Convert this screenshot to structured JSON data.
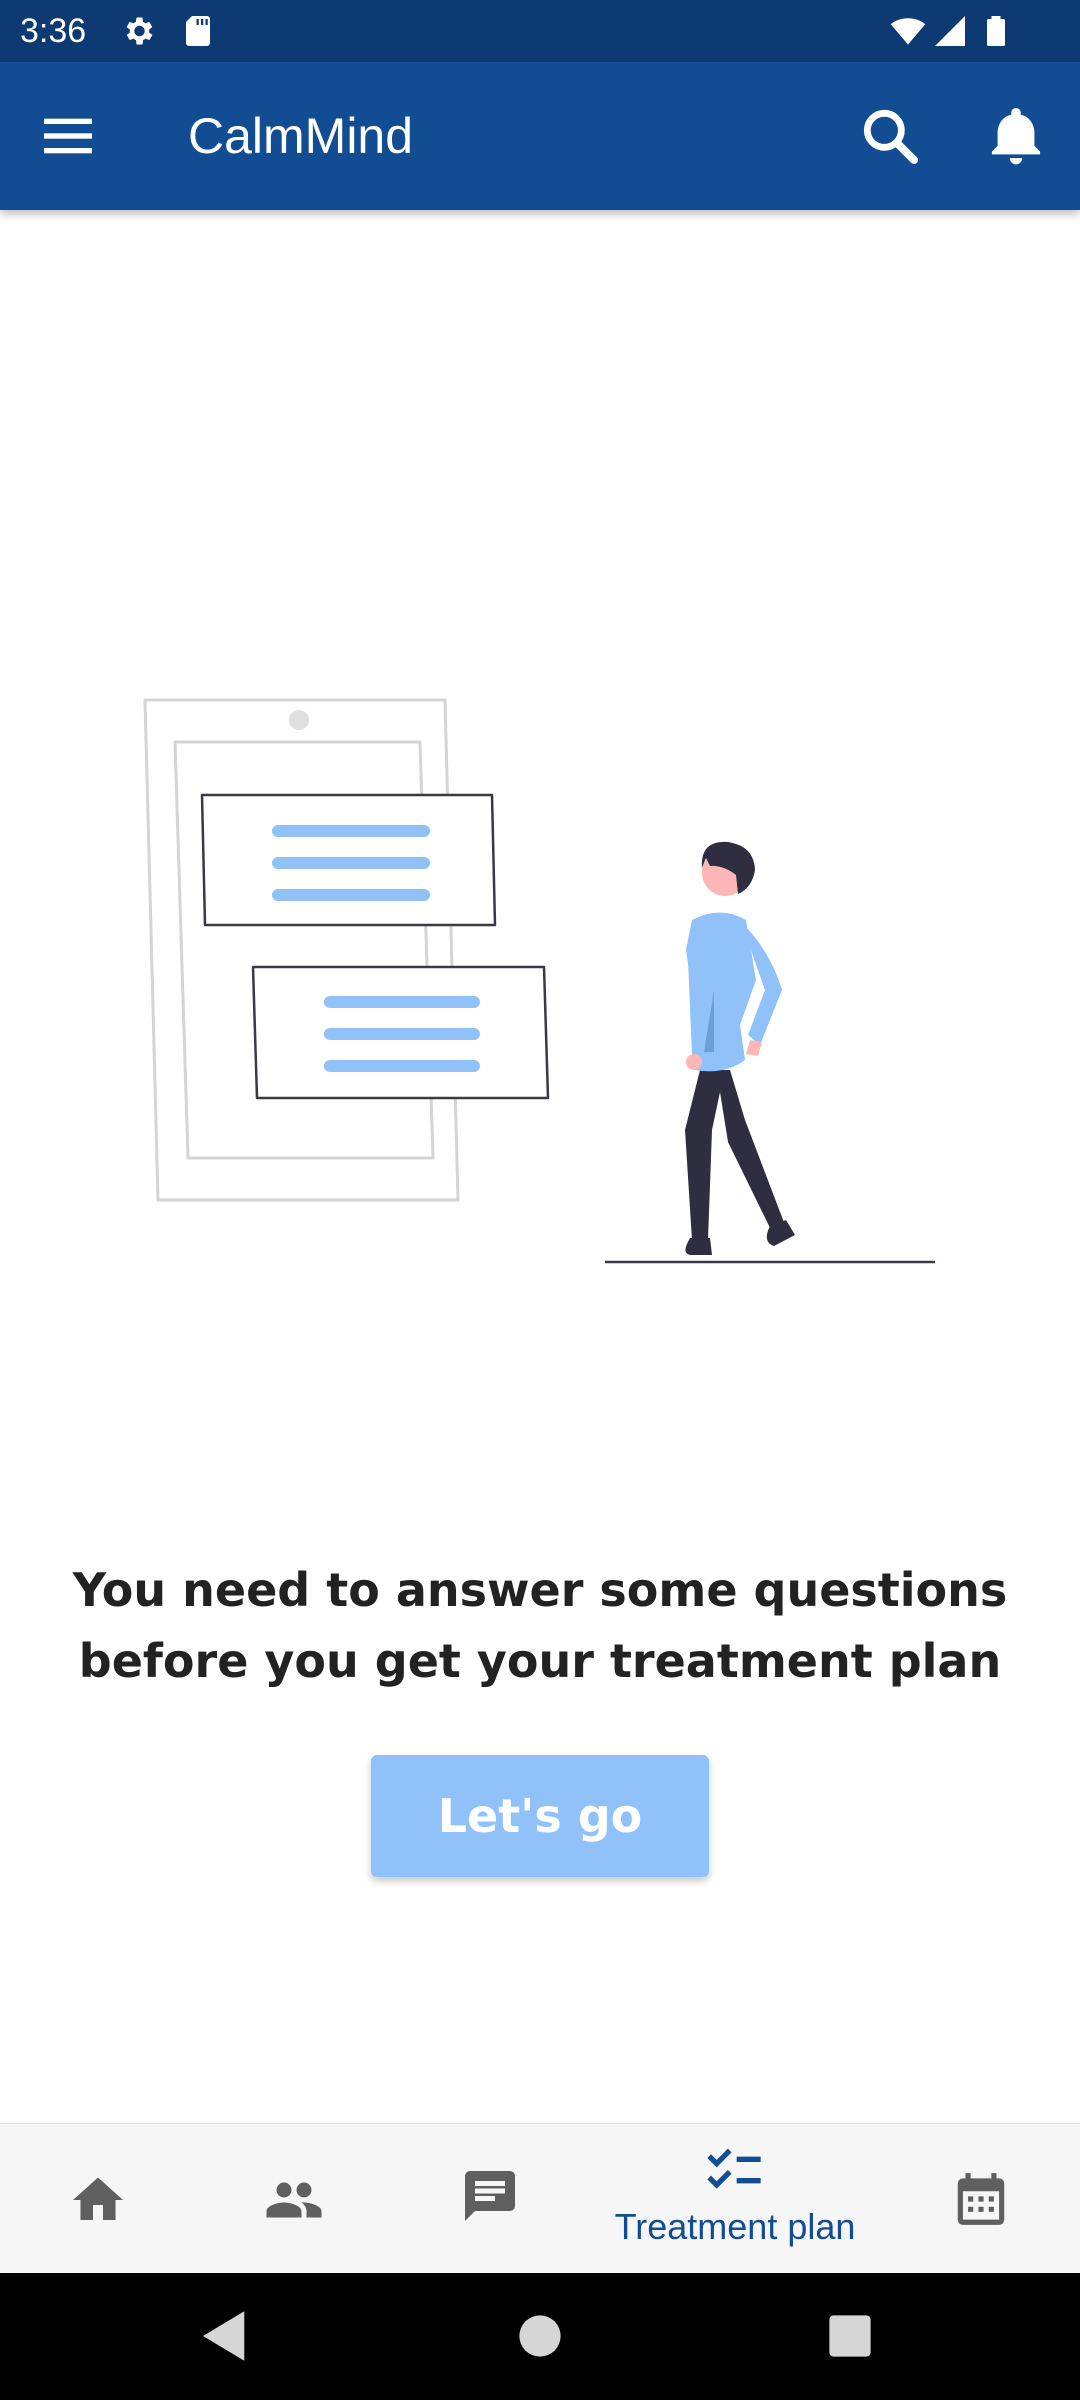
{
  "status_bar": {
    "time": "3:36",
    "icons": [
      "gear-icon",
      "sd-card-icon",
      "wifi-icon",
      "signal-icon",
      "battery-icon"
    ]
  },
  "app_bar": {
    "title": "CalmMind",
    "icons": [
      "menu-icon",
      "search-icon",
      "bell-icon"
    ]
  },
  "main": {
    "message": "You need to answer some questions before you get your treatment plan",
    "cta_label": "Let's go"
  },
  "bottom_nav": {
    "items": [
      {
        "icon": "home-icon",
        "label": ""
      },
      {
        "icon": "people-icon",
        "label": ""
      },
      {
        "icon": "chat-icon",
        "label": ""
      },
      {
        "icon": "checklist-icon",
        "label": "Treatment plan",
        "selected": true
      },
      {
        "icon": "calendar-icon",
        "label": ""
      }
    ]
  },
  "colors": {
    "status_bar": "#0d3a73",
    "app_bar": "#124d93",
    "accent_light": "#90c2f9",
    "nav_selected": "#124d93",
    "nav_unselected": "#5f5f5f"
  }
}
